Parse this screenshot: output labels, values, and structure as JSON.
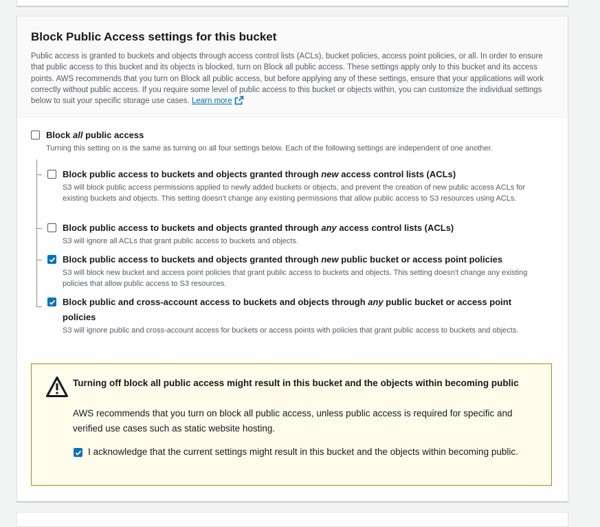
{
  "header": {
    "title": "Block Public Access settings for this bucket",
    "description": "Public access is granted to buckets and objects through access control lists (ACLs), bucket policies, access point policies, or all. In order to ensure that public access to this bucket and its objects is blocked, turn on Block all public access. These settings apply only to this bucket and its access points. AWS recommends that you turn on Block all public access, but before applying any of these settings, ensure that your applications will work correctly without public access. If you require some level of public access to this bucket or objects within, you can customize the individual settings below to suit your specific storage use cases.",
    "learn_more": "Learn more"
  },
  "block_all": {
    "label_pre": "Block ",
    "label_em": "all",
    "label_post": " public access",
    "description": "Turning this setting on is the same as turning on all four settings below. Each of the following settings are independent of one another.",
    "checked": false
  },
  "options": [
    {
      "label_pre": "Block public access to buckets and objects granted through ",
      "label_em": "new",
      "label_post": " access control lists (ACLs)",
      "description": "S3 will block public access permissions applied to newly added buckets or objects, and prevent the creation of new public access ACLs for existing buckets and objects. This setting doesn't change any existing permissions that allow public access to S3 resources using ACLs.",
      "checked": false
    },
    {
      "label_pre": "Block public access to buckets and objects granted through ",
      "label_em": "any",
      "label_post": " access control lists (ACLs)",
      "description": "S3 will ignore all ACLs that grant public access to buckets and objects.",
      "checked": false
    },
    {
      "label_pre": "Block public access to buckets and objects granted through ",
      "label_em": "new",
      "label_post": " public bucket or access point policies",
      "description": "S3 will block new bucket and access point policies that grant public access to buckets and objects. This setting doesn't change any existing policies that allow public access to S3 resources.",
      "checked": true
    },
    {
      "label_pre": "Block public and cross-account access to buckets and objects through ",
      "label_em": "any",
      "label_post": " public bucket or access point policies",
      "description": "S3 will ignore public and cross-account access for buckets or access points with policies that grant public access to buckets and objects.",
      "checked": true
    }
  ],
  "alert": {
    "title": "Turning off block all public access might result in this bucket and the objects within becoming public",
    "body": "AWS recommends that you turn on block all public access, unless public access is required for specific and verified use cases such as static website hosting.",
    "acknowledge": "I acknowledge that the current settings might result in this bucket and the objects within becoming public.",
    "acknowledged": true
  },
  "colors": {
    "accent": "#0073bb",
    "warning_border": "#b58a00",
    "warning_bg": "#fffcec"
  }
}
